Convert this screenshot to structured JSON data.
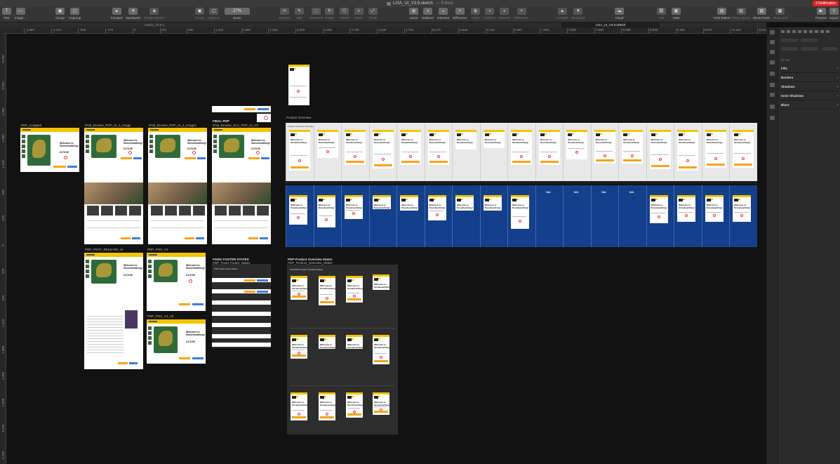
{
  "window": {
    "title": "LISA_UI_V3.9.sketch",
    "edited": "— Edited",
    "notification": "2 Notification"
  },
  "toolbar": {
    "items": [
      {
        "label": "Text",
        "icon": "T"
      },
      {
        "label": "Image...",
        "icon": "▭"
      },
      {
        "label": "Group",
        "icon": "▣"
      },
      {
        "label": "Ungroup",
        "icon": "▢"
      },
      {
        "label": "Forward",
        "icon": "▲"
      },
      {
        "label": "Backward",
        "icon": "▼"
      },
      {
        "label": "Create Symbol",
        "icon": "◈"
      },
      {
        "label": "Group",
        "icon": "▣"
      },
      {
        "label": "Ungroup",
        "icon": "▢"
      },
      {
        "label": "Zoom",
        "icon": "27%"
      },
      {
        "label": "Scissors",
        "icon": "✂"
      },
      {
        "label": "Edit",
        "icon": "✎"
      },
      {
        "label": "Transform",
        "icon": "⬚"
      },
      {
        "label": "Rotate",
        "icon": "↻"
      },
      {
        "label": "Flatten",
        "icon": "⬡"
      },
      {
        "label": "Mask",
        "icon": "◐"
      },
      {
        "label": "Scale",
        "icon": "⤢"
      },
      {
        "label": "Union",
        "icon": "◍"
      },
      {
        "label": "Subtract",
        "icon": "◑"
      },
      {
        "label": "Intersect",
        "icon": "◒"
      },
      {
        "label": "Difference",
        "icon": "◓"
      },
      {
        "label": "Union",
        "icon": "◍"
      },
      {
        "label": "Subtract",
        "icon": "◑"
      },
      {
        "label": "Intersect",
        "icon": "◒"
      },
      {
        "label": "Difference",
        "icon": "◓"
      },
      {
        "label": "Forward",
        "icon": "▲"
      },
      {
        "label": "Backward",
        "icon": "▼"
      },
      {
        "label": "Cloud",
        "icon": "☁"
      },
      {
        "label": "Link",
        "icon": "⛓"
      },
      {
        "label": "View",
        "icon": "▦"
      },
      {
        "label": "Hide Rulers",
        "icon": "▤"
      },
      {
        "label": "Show Layout",
        "icon": "▥"
      },
      {
        "label": "Show Pixels",
        "icon": "▧"
      },
      {
        "label": "Show Grid",
        "icon": "▩"
      },
      {
        "label": "Preview",
        "icon": "▶"
      },
      {
        "label": "Export",
        "icon": "⇪"
      }
    ]
  },
  "doc_tabs": {
    "tab1": "LEGO_V3.9.1",
    "tab2": "LISA_UI_V3.9.sketch"
  },
  "rulers": {
    "h_ticks": [
      "-1,880",
      "-1,410",
      "-940",
      "-470",
      "0",
      "470",
      "940",
      "1,410",
      "1,880",
      "2,350",
      "2,820",
      "3,290",
      "3,760",
      "4,230",
      "4,700",
      "5,170",
      "5,640",
      "6,110",
      "6,580",
      "7,050",
      "7,520",
      "7,990",
      "8,460",
      "8,930",
      "9,400",
      "9,870",
      "10,340",
      "10,810"
    ],
    "v_ticks": [
      "-3,290",
      "-2,820",
      "-2,350",
      "-1,880",
      "-1,410",
      "-940",
      "-470",
      "0",
      "470",
      "940",
      "1,410",
      "1,880",
      "2,350",
      "2,820",
      "3,290",
      "3,760"
    ]
  },
  "artboards": {
    "pdp_cropped": "PDP_Cropped",
    "ipad_browse_1": "IPad_Browse_PDP_UI_1_Image",
    "ipad_browse_4": "IPad_Browse_PDP_UI_4_Images",
    "final_pdp": "FINAL PDP",
    "ipad_browse_slc": "IPad_Browse_SLC_PDP_UI_V3",
    "product_overview": "Product Overview",
    "pdp_post_release": "PDP_POST_RELEASE_UI",
    "pdp_poc_v1": "PDP_POC_V1",
    "pdp_poc_v1_alt": "PDP_POC_V1_Alt",
    "fixed_footer": "FIXED FOOTER STATES",
    "fixed_footer_sub": "PDP_Fixed_Footer_States",
    "footer_inner": "PDP Fixed Footer States",
    "product_states": "PDP Product Overview States",
    "product_states_sub": "PDP_Product_Overview_States",
    "product_states_inner": "LISA PDP Product Overview States",
    "welcome": "Welcome to Stonehearthing!",
    "price": "£179.99",
    "po_header": "Product Overview Template",
    "na_label": "N/A"
  },
  "inspector": {
    "style_label": "STYLE",
    "sections": [
      "Fills",
      "Borders",
      "Shadows",
      "Inner Shadows",
      "Blurs"
    ],
    "plus": "+"
  }
}
